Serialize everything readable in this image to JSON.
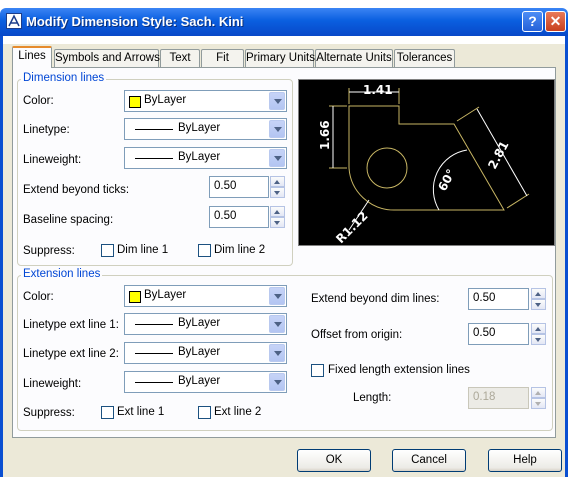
{
  "window": {
    "title": "Modify Dimension Style: Sach. Kini",
    "help_glyph": "?",
    "close_glyph": "✕"
  },
  "tabs": [
    "Lines",
    "Symbols and Arrows",
    "Text",
    "Fit",
    "Primary Units",
    "Alternate Units",
    "Tolerances"
  ],
  "dimension_lines": {
    "legend": "Dimension lines",
    "color_label": "Color:",
    "color_value": "ByLayer",
    "color_swatch": "#ffff00",
    "linetype_label": "Linetype:",
    "linetype_value": "ByLayer",
    "lineweight_label": "Lineweight:",
    "lineweight_value": "ByLayer",
    "extend_label": "Extend beyond ticks:",
    "extend_value": "0.50",
    "baseline_label": "Baseline spacing:",
    "baseline_value": "0.50",
    "suppress_label": "Suppress:",
    "dim_line_1": "Dim line 1",
    "dim_line_2": "Dim line 2"
  },
  "extension_lines": {
    "legend": "Extension lines",
    "color_label": "Color:",
    "color_value": "ByLayer",
    "linetype1_label": "Linetype ext line 1:",
    "linetype1_value": "ByLayer",
    "linetype2_label": "Linetype ext line 2:",
    "linetype2_value": "ByLayer",
    "lineweight_label": "Lineweight:",
    "lineweight_value": "ByLayer",
    "suppress_label": "Suppress:",
    "ext_line_1": "Ext line 1",
    "ext_line_2": "Ext line 2",
    "extend_dim_label": "Extend beyond dim lines:",
    "extend_dim_value": "0.50",
    "offset_label": "Offset from origin:",
    "offset_value": "0.50",
    "fixed_length_label": "Fixed length extension lines",
    "length_label": "Length:",
    "length_value": "0.18"
  },
  "preview": {
    "dim_top": "1.41",
    "dim_left": "1.66",
    "dim_diag": "2.81",
    "dim_angle": "60°",
    "dim_radius": "R1.12"
  },
  "buttons": {
    "ok": "OK",
    "cancel": "Cancel",
    "help": "Help"
  }
}
